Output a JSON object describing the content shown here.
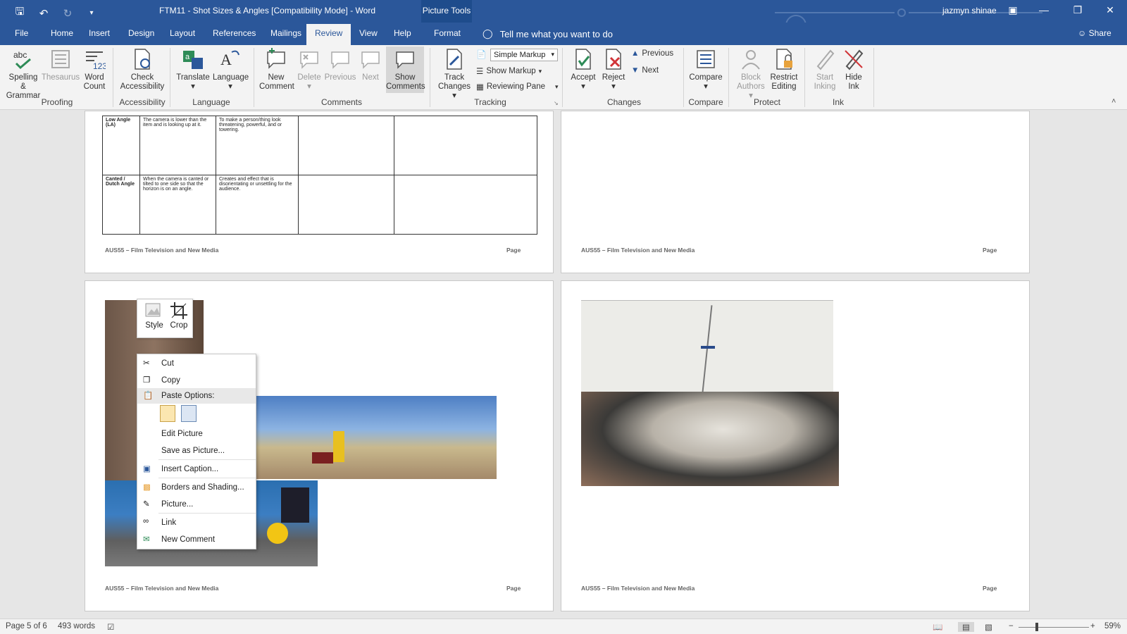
{
  "window": {
    "title": "FTM11 - Shot Sizes & Angles [Compatibility Mode]  -  Word",
    "context_tab_header": "Picture Tools",
    "user": "jazmyn shinae"
  },
  "tabs": [
    "File",
    "Home",
    "Insert",
    "Design",
    "Layout",
    "References",
    "Mailings",
    "Review",
    "View",
    "Help",
    "Format"
  ],
  "active_tab": "Review",
  "tell_me": "Tell me what you want to do",
  "share": "Share",
  "ribbon": {
    "proofing": {
      "spelling": "Spelling &",
      "spelling2": "Grammar",
      "thesaurus": "Thesaurus",
      "wordcount": "Word",
      "wordcount2": "Count",
      "label": "Proofing"
    },
    "accessibility": {
      "check": "Check",
      "check2": "Accessibility",
      "label": "Accessibility"
    },
    "language": {
      "translate": "Translate",
      "language": "Language",
      "label": "Language"
    },
    "comments": {
      "new": "New",
      "new2": "Comment",
      "delete": "Delete",
      "previous": "Previous",
      "next": "Next",
      "show": "Show",
      "show2": "Comments",
      "label": "Comments"
    },
    "tracking": {
      "track": "Track",
      "track2": "Changes",
      "markup": "Simple Markup",
      "show_markup": "Show Markup",
      "reviewing_pane": "Reviewing Pane",
      "label": "Tracking"
    },
    "changes": {
      "accept": "Accept",
      "reject": "Reject",
      "previous": "Previous",
      "next": "Next",
      "label": "Changes"
    },
    "compare": {
      "compare": "Compare",
      "label": "Compare"
    },
    "protect": {
      "block": "Block",
      "block2": "Authors",
      "restrict": "Restrict",
      "restrict2": "Editing",
      "label": "Protect"
    },
    "ink": {
      "start": "Start",
      "start2": "Inking",
      "hide": "Hide",
      "hide2": "Ink",
      "label": "Ink"
    }
  },
  "table": {
    "rows": [
      {
        "name": "Low Angle (LA)",
        "desc": "The camera is lower than the item and is looking up at it.",
        "purpose": "To make a person/thing look threatening, powerful, and or towering."
      },
      {
        "name": "Canted / Dutch Angle",
        "desc": "When the camera is canted or tilted to one side so that the horizon is on an angle.",
        "purpose": "Creates and effect that is disorientating or unsettling for the audience."
      }
    ]
  },
  "footer": {
    "left": "AUS55 – Film Television and New Media",
    "right": "Page"
  },
  "mini_toolbar": {
    "style": "Style",
    "crop": "Crop"
  },
  "context_menu": {
    "cut": "Cut",
    "copy": "Copy",
    "paste_options": "Paste Options:",
    "edit_picture": "Edit Picture",
    "save_as_picture": "Save as Picture...",
    "insert_caption": "Insert Caption...",
    "borders_shading": "Borders and Shading...",
    "picture": "Picture...",
    "link": "Link",
    "new_comment": "New Comment"
  },
  "status": {
    "page": "Page 5 of 6",
    "words": "493 words",
    "zoom": "59%"
  },
  "colors": {
    "word_blue": "#2b579a",
    "ribbon_bg": "#f3f3f3"
  }
}
